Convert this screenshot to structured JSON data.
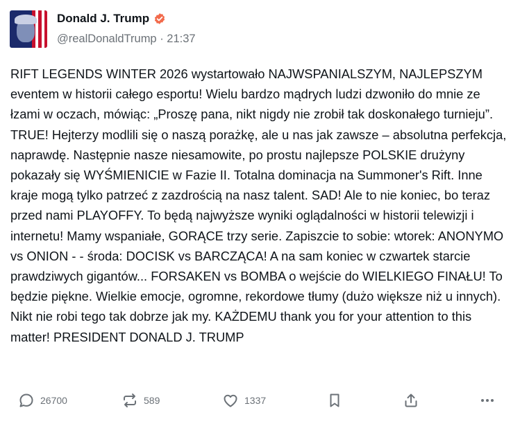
{
  "author": {
    "name": "Donald J. Trump",
    "handle": "@realDonaldTrump",
    "separator": " · ",
    "time": "21:37",
    "verified_color": "#f26a4b"
  },
  "post": {
    "text": "RIFT LEGENDS WINTER 2026 wystartowało NAJWSPANIALSZYM, NAJLEPSZYM eventem w historii całego esportu! Wielu bardzo mądrych ludzi dzwoniło do mnie ze łzami w oczach, mówiąc: „Proszę pana, nikt nigdy nie zrobił tak doskonałego turnieju”. TRUE! Hejterzy modlili się o naszą porażkę, ale u nas jak zawsze – absolutna perfekcja, naprawdę. Następnie nasze niesamowite, po prostu najlepsze POLSKIE drużyny pokazały się WYŚMIENICIE w Fazie II. Totalna dominacja na Summoner's Rift. Inne kraje mogą tylko patrzeć z zazdrością na nasz talent. SAD! Ale to nie koniec, bo teraz przed nami PLAYOFFY. To będą najwyższe wyniki oglądalności w historii telewizji i internetu! Mamy wspaniałe, GORĄCE trzy serie. Zapiszcie to sobie: wtorek: ANONYMO vs ONION - - środa: DOCISK vs BARCZĄCA! A na sam koniec w czwartek starcie prawdziwych gigantów... FORSAKEN vs BOMBA o wejście do WIELKIEGO FINAŁU! To będzie piękne. Wielkie emocje, ogromne, rekordowe tłumy (dużo większe niż u innych). Nikt nie robi tego tak dobrze jak my. KAŻDEMU thank you for your attention to this matter! PRESIDENT DONALD J. TRUMP"
  },
  "actions": {
    "replies": "26700",
    "reposts": "589",
    "likes": "1337",
    "icons": [
      "reply-icon",
      "repost-icon",
      "like-icon",
      "bookmark-icon",
      "share-icon",
      "more-icon"
    ]
  }
}
